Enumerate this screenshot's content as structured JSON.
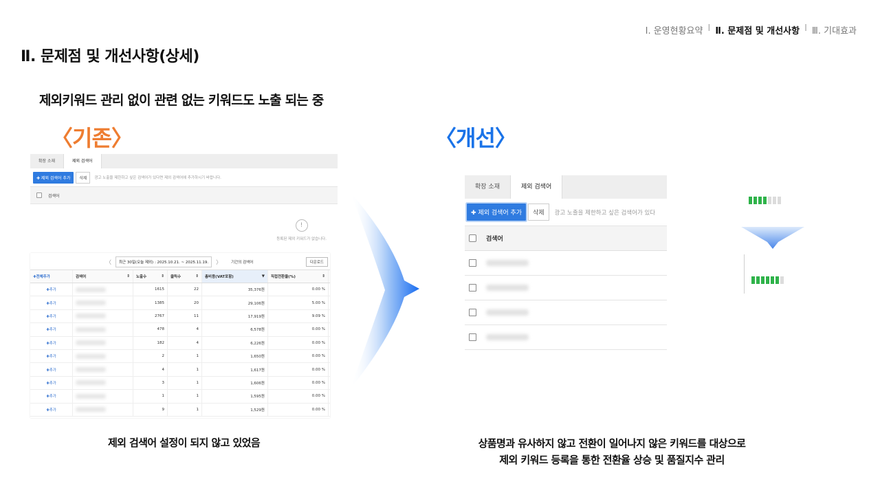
{
  "nav": {
    "item1": "Ⅰ. 운영현황요약",
    "sep1": "I",
    "item2": "Ⅱ. 문제점 및 개선사항",
    "sep2": "I",
    "item3": "Ⅲ. 기대효과"
  },
  "page_title": "Ⅱ. 문제점 및 개선사항(상세)",
  "subtitle": "제외키워드 관리 없이 관련 없는 키워드도 노출 되는 중",
  "before": {
    "label": "〈기존〉",
    "panel": {
      "tabs": [
        "확장 소재",
        "제외 검색어"
      ],
      "add_button": "✚ 제외 검색어 추가",
      "delete_button": "삭제",
      "hint": "광고 노출을 제한하고 싶은 검색어가 있다면 제외 검색어에 추가하시기 바랍니다.",
      "header": "검색어",
      "empty_icon": "!",
      "empty_message": "등록된 제외 키워드가 없습니다."
    },
    "table": {
      "date_prev": "〈",
      "date_range": "최근 30일(오늘 제외) : 2025.10.21. ~ 2025.11.19.",
      "date_next": "〉",
      "period_label": "기간의 검색어",
      "download": "다운로드",
      "columns": [
        "✚전체추가",
        "검색어",
        "노출수",
        "클릭수",
        "총비용(VAT포함)",
        "직접전환율(%)"
      ],
      "sort_icon": "⇕",
      "sort_active_icon": "▼",
      "rows": [
        {
          "add": "✚추가",
          "imp": "1615",
          "clk": "22",
          "cost": "35,376원",
          "cvr": "0.00 %"
        },
        {
          "add": "✚추가",
          "imp": "1385",
          "clk": "20",
          "cost": "29,106원",
          "cvr": "5.00 %"
        },
        {
          "add": "✚추가",
          "imp": "2767",
          "clk": "11",
          "cost": "17,919원",
          "cvr": "9.09 %"
        },
        {
          "add": "✚추가",
          "imp": "478",
          "clk": "4",
          "cost": "6,578원",
          "cvr": "0.00 %"
        },
        {
          "add": "✚추가",
          "imp": "182",
          "clk": "4",
          "cost": "6,226원",
          "cvr": "0.00 %"
        },
        {
          "add": "✚추가",
          "imp": "2",
          "clk": "1",
          "cost": "1,650원",
          "cvr": "0.00 %"
        },
        {
          "add": "✚추가",
          "imp": "4",
          "clk": "1",
          "cost": "1,617원",
          "cvr": "0.00 %"
        },
        {
          "add": "✚추가",
          "imp": "3",
          "clk": "1",
          "cost": "1,606원",
          "cvr": "0.00 %"
        },
        {
          "add": "✚추가",
          "imp": "1",
          "clk": "1",
          "cost": "1,595원",
          "cvr": "0.00 %"
        },
        {
          "add": "✚추가",
          "imp": "9",
          "clk": "1",
          "cost": "1,529원",
          "cvr": "0.00 %"
        }
      ]
    },
    "caption": "제외 검색어 설정이 되지 않고 있었음"
  },
  "after": {
    "label": "〈개선〉",
    "panel": {
      "tabs": [
        "확장 소재",
        "제외 검색어"
      ],
      "add_button": "✚ 제외 검색어 추가",
      "delete_button": "삭제",
      "hint": "광고 노출을 제한하고 싶은 검색어가 있다",
      "header": "검색어",
      "row_count": 4
    },
    "quality_meter": {
      "before_level": 0.55,
      "after_level": 0.86,
      "color_on": "#2fb34a",
      "color_off": "#dcdcdc"
    },
    "caption_line1": "상품명과 유사하지 않고 전환이 일어나지 않은 키워드를 대상으로",
    "caption_line2": "제외 키워드 등록을 통한 전환율 상승 및 품질지수 관리"
  },
  "colors": {
    "before_accent": "#ee7d31",
    "after_accent": "#1a73e8",
    "button_blue": "#2f7be0"
  }
}
